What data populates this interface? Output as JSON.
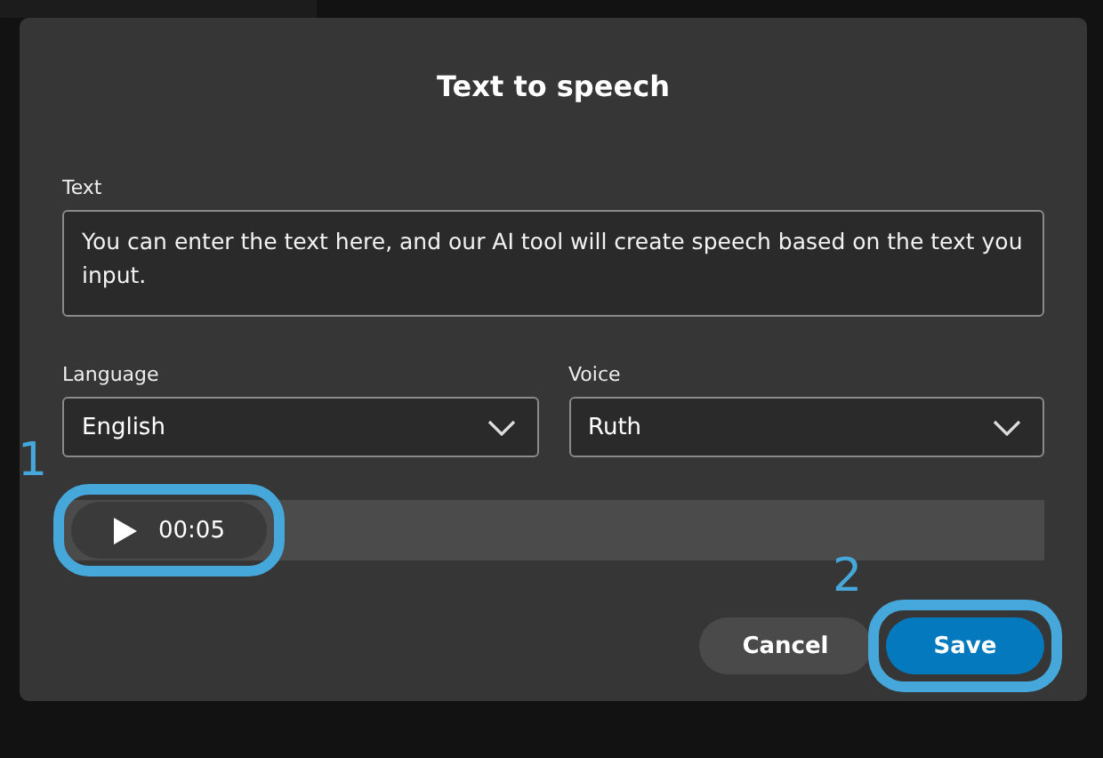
{
  "dialog": {
    "title": "Text to speech",
    "text_field": {
      "label": "Text",
      "value": "You can enter the text here, and our AI tool will create speech based on the text you input."
    },
    "selects": [
      {
        "label": "Language",
        "value": "English"
      },
      {
        "label": "Voice",
        "value": "Ruth"
      }
    ],
    "player": {
      "time": "00:05",
      "callout": "1"
    },
    "buttons": [
      {
        "label": "Cancel",
        "kind": "secondary"
      },
      {
        "label": "Save",
        "kind": "primary",
        "callout": "2"
      }
    ]
  }
}
